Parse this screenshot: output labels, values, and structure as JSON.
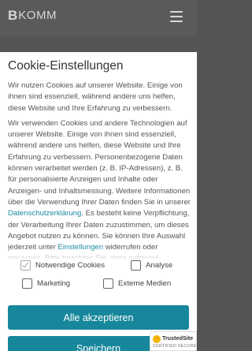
{
  "header": {
    "logo_b": "B",
    "logo_rest": "KOMM",
    "menu_icon": "hamburger-icon"
  },
  "cookie": {
    "title": "Cookie-Einstellungen",
    "intro": "Wir nutzen Cookies auf unserer Website. Einige von ihnen sind essenziell, während andere uns helfen, diese Website und Ihre Erfahrung zu verbessern.",
    "detail_part1": "Wir verwenden Cookies und andere Technologien auf unserer Website. Einige von ihnen sind essenziell, während andere uns helfen, diese Website und Ihre Erfahrung zu verbessern. Personenbezogene Daten können verarbeitet werden (z. B. IP-Adressen), z. B. für personalisierte Anzeigen und Inhalte oder Anzeigen- und Inhaltsmessung. Weitere Informationen über die Verwendung Ihrer Daten finden Sie in unserer",
    "privacy_link": "Datenschutzerklärung",
    "detail_part2": ". Es besteht keine Verpflichtung, der Verarbeitung Ihrer Daten zuzustimmen, um dieses Angebot nutzen zu können. Sie können Ihre Auswahl jederzeit unter",
    "settings_link": "Einstellungen",
    "detail_part3": "widerrufen oder anpassen. Bitte beachten Sie, dass aufgrund individueller",
    "options": {
      "necessary": {
        "label": "Notwendige Cookies",
        "checked": true
      },
      "analytics": {
        "label": "Analyse",
        "checked": false
      },
      "marketing": {
        "label": "Marketing",
        "checked": false
      },
      "external": {
        "label": "Externe Medien",
        "checked": false
      }
    },
    "accept_all_label": "Alle akzeptieren",
    "save_label": "Speichern",
    "accent_color": "#17879b"
  },
  "trusted_badge": {
    "name": "TrustedSite",
    "sub": "CERTIFIED SECURE",
    "seal_icon": "check-seal-icon"
  }
}
